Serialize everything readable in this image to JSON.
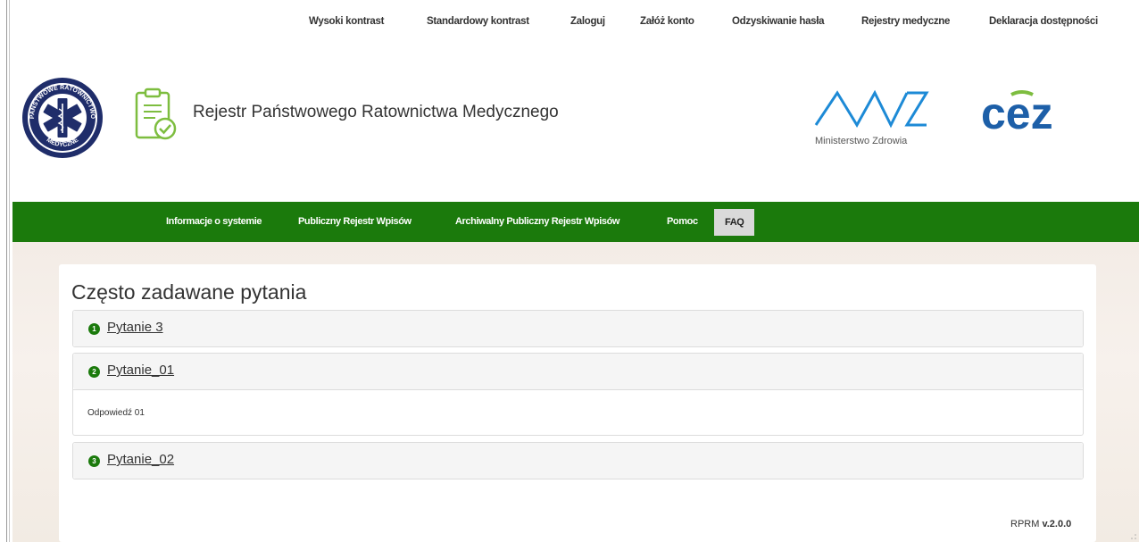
{
  "top_links": [
    {
      "label": "Wysoki kontrast"
    },
    {
      "label": "Standardowy kontrast"
    },
    {
      "label": "Zaloguj"
    },
    {
      "label": "Załóż konto"
    },
    {
      "label": "Odzyskiwanie hasła"
    },
    {
      "label": "Rejestry medyczne"
    },
    {
      "label": "Deklaracja dostępności"
    }
  ],
  "header": {
    "emblem_icon": "pro-emergency-medical-emblem-icon",
    "emblem_text_top": "PAŃSTWOWE RATOWNICTWO",
    "emblem_text_bottom": "MEDYCZNE",
    "clipboard_icon": "clipboard-check-icon",
    "title": "Rejestr Państwowego Ratownictwa Medycznego",
    "mz_label": "Ministerstwo Zdrowia",
    "cez_logo_text": "cez",
    "brand_blue": "#1d8ad6",
    "brand_green": "#7dbd3f"
  },
  "nav": {
    "items": [
      {
        "label": "Informacje o systemie"
      },
      {
        "label": "Publiczny Rejestr Wpisów"
      },
      {
        "label": "Archiwalny Publiczny Rejestr Wpisów"
      },
      {
        "label": "Pomoc"
      },
      {
        "label": "FAQ",
        "active": true
      }
    ],
    "bg_color": "#1b7a0c"
  },
  "faq": {
    "title": "Często zadawane pytania",
    "items": [
      {
        "num": "1",
        "question": "Pytanie 3",
        "expanded": false,
        "answer": ""
      },
      {
        "num": "2",
        "question": "Pytanie_01",
        "expanded": true,
        "answer": "Odpowiedź 01"
      },
      {
        "num": "3",
        "question": "Pytanie_02",
        "expanded": false,
        "answer": ""
      }
    ]
  },
  "footer": {
    "version_prefix": "RPRM ",
    "version": "v.2.0.0"
  }
}
